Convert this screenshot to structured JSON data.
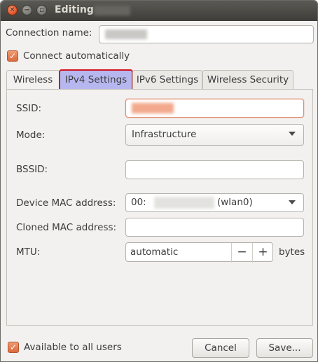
{
  "window": {
    "title": "Editing"
  },
  "connection": {
    "name_label": "Connection name:",
    "name_value": ""
  },
  "connect_automatically": {
    "label": "Connect automatically",
    "checked": true
  },
  "tabs": [
    {
      "label": "Wireless",
      "active": true
    },
    {
      "label": "IPv4 Settings",
      "highlighted": true
    },
    {
      "label": "IPv6 Settings"
    },
    {
      "label": "Wireless Security"
    }
  ],
  "wireless": {
    "ssid_label": "SSID:",
    "ssid_value": "",
    "mode_label": "Mode:",
    "mode_value": "Infrastructure",
    "bssid_label": "BSSID:",
    "bssid_value": "",
    "device_mac_label": "Device MAC address:",
    "device_mac_prefix": "00:",
    "device_mac_suffix": "(wlan0)",
    "cloned_mac_label": "Cloned MAC address:",
    "cloned_mac_value": "",
    "mtu_label": "MTU:",
    "mtu_value": "automatic",
    "mtu_minus": "−",
    "mtu_plus": "+",
    "mtu_unit": "bytes"
  },
  "available_all_users": {
    "label": "Available to all users",
    "checked": true
  },
  "buttons": {
    "cancel": "Cancel",
    "save": "Save..."
  },
  "colors": {
    "accent": "#dd6a3c",
    "highlight_tab": "#b7b7f0",
    "highlight_border": "#d2131e",
    "titlebar": "#3e3d39"
  }
}
